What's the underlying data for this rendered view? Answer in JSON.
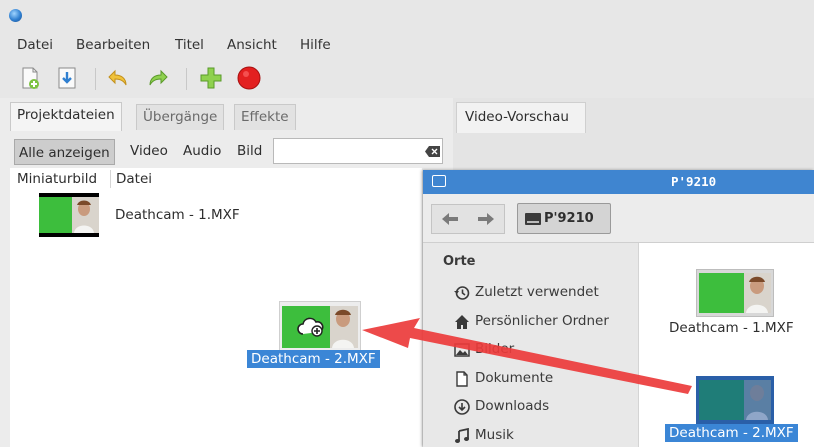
{
  "menu": [
    "Datei",
    "Bearbeiten",
    "Titel",
    "Ansicht",
    "Hilfe"
  ],
  "toolbar_icons": [
    "new-project-icon",
    "save-icon",
    "undo-icon",
    "redo-icon",
    "add-file-icon",
    "record-icon"
  ],
  "left_tabs": [
    "Projektdateien",
    "Übergänge",
    "Effekte"
  ],
  "filter": {
    "all_label": "Alle anzeigen",
    "options": [
      "Video",
      "Audio",
      "Bild"
    ],
    "search_value": ""
  },
  "columns": {
    "thumbnail": "Miniaturbild",
    "file": "Datei"
  },
  "project_files": [
    {
      "name": "Deathcam - 1.MXF"
    }
  ],
  "drag_item": {
    "label": "Deathcam - 2.MXF",
    "icon": "cloud-plus-icon"
  },
  "preview_tab": "Video-Vorschau",
  "file_manager": {
    "title": "P'9210",
    "path_button": "P'9210",
    "places_header": "Orte",
    "places": [
      {
        "label": "Zuletzt verwendet",
        "icon": "recent-icon"
      },
      {
        "label": "Persönlicher Ordner",
        "icon": "home-icon"
      },
      {
        "label": "Bilder",
        "icon": "pictures-icon"
      },
      {
        "label": "Dokumente",
        "icon": "document-icon"
      },
      {
        "label": "Downloads",
        "icon": "download-icon"
      },
      {
        "label": "Musik",
        "icon": "music-icon"
      }
    ],
    "files": [
      {
        "name": "Deathcam - 1.MXF",
        "selected": false
      },
      {
        "name": "Deathcam - 2.MXF",
        "selected": true
      }
    ]
  },
  "colors": {
    "selection": "#3b86d6",
    "annotation_arrow": "#ec3b3b",
    "video_green": "#3dbe3d"
  }
}
